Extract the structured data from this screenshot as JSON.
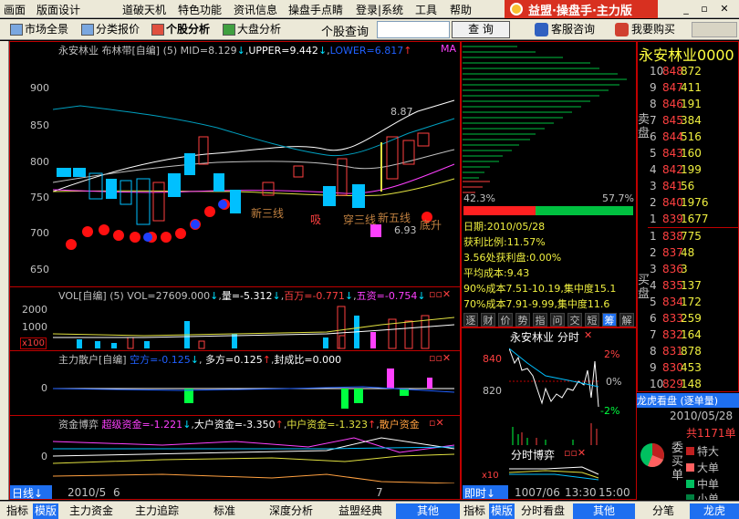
{
  "menu": [
    "画面",
    "版面设计",
    "道破天机",
    "特色功能",
    "资讯信息",
    "操盘手点睛",
    "登录|系统",
    "工具",
    "帮助"
  ],
  "brand": "益盟·操盘手·主力版",
  "toolbar": {
    "items": [
      "市场全景",
      "分类报价",
      "个股分析",
      "大盘分析"
    ],
    "search_label": "个股查询",
    "search_value": "",
    "search_button": "查 询",
    "service": "客服咨询",
    "buy": "我要购买"
  },
  "stock": {
    "name": "永安林业",
    "code": "0000"
  },
  "main_chart": {
    "title": "永安林业 布林带[自编] (5)",
    "mid": "MID=8.129",
    "upper": "UPPER=9.442",
    "lower": "LOWER=6.817",
    "ma": "MA",
    "y_ticks": [
      "900",
      "850",
      "800",
      "750",
      "700",
      "650"
    ],
    "annotations": {
      "high": "8.87",
      "low": "6.93"
    },
    "signals": [
      "新三线",
      "吸",
      "穿三线",
      "新五线",
      "底升"
    ]
  },
  "vol_panel": {
    "title": "VOL[自编] (5) VOL=27609.000",
    "t2": "量=-5.312",
    "t3": "百万=-0.771",
    "t4": "五资=-0.754",
    "y_ticks": [
      "2000",
      "1000"
    ],
    "unit": "x100"
  },
  "zhuli_panel": {
    "title": "主力散户[自编]",
    "t1": "空方=-0.125",
    "t2": "多方=0.125",
    "t3": "封成比=0.000",
    "y_ticks": [
      "0"
    ]
  },
  "boyi_panel": {
    "title": "资金博弈",
    "t1": "超级资金=-1.221",
    "t2": "大户资金=-3.350",
    "t3": "中户资金=-1.323",
    "t4": "散户资金",
    "y_ticks": [
      "0"
    ]
  },
  "x_axis": {
    "period": "日线",
    "dates": [
      "2010/5",
      "6",
      "7"
    ]
  },
  "profile": {
    "pct_left": "42.3%",
    "pct_right": "57.7%",
    "lines": [
      "日期:2010/05/28",
      "获利比例:11.57%",
      "3.56处获利盘:0.00%",
      "平均成本:9.43",
      "90%成本7.51-10.19,集中度15.1",
      "70%成本7.91-9.99,集中度11.6"
    ],
    "tabs": [
      "逐",
      "财",
      "价",
      "势",
      "指",
      "问",
      "交",
      "短",
      "筹",
      "解"
    ]
  },
  "intraday": {
    "title": "永安林业 分时",
    "y_left": [
      "840",
      "820"
    ],
    "y_right": [
      "2%",
      "0%",
      "-2%"
    ],
    "vol_unit": "x10",
    "boyi_title": "分时博弈",
    "period": "即时",
    "dates": [
      "1007/06",
      "13:30",
      "15:00"
    ]
  },
  "orderbook": {
    "sell_label": "卖盘",
    "buy_label": "买盘",
    "sells": [
      {
        "n": "10",
        "p": "848",
        "v": "872"
      },
      {
        "n": "9",
        "p": "847",
        "v": "411"
      },
      {
        "n": "8",
        "p": "846",
        "v": "191"
      },
      {
        "n": "7",
        "p": "845",
        "v": "384"
      },
      {
        "n": "6",
        "p": "844",
        "v": "516"
      },
      {
        "n": "5",
        "p": "843",
        "v": "160"
      },
      {
        "n": "4",
        "p": "842",
        "v": "199"
      },
      {
        "n": "3",
        "p": "841",
        "v": "56"
      },
      {
        "n": "2",
        "p": "840",
        "v": "1976"
      },
      {
        "n": "1",
        "p": "839",
        "v": "1677"
      }
    ],
    "buys": [
      {
        "n": "1",
        "p": "838",
        "v": "775"
      },
      {
        "n": "2",
        "p": "837",
        "v": "48"
      },
      {
        "n": "3",
        "p": "836",
        "v": "3"
      },
      {
        "n": "4",
        "p": "835",
        "v": "137"
      },
      {
        "n": "5",
        "p": "834",
        "v": "172"
      },
      {
        "n": "6",
        "p": "833",
        "v": "259"
      },
      {
        "n": "7",
        "p": "832",
        "v": "164"
      },
      {
        "n": "8",
        "p": "831",
        "v": "878"
      },
      {
        "n": "9",
        "p": "830",
        "v": "453"
      },
      {
        "n": "10",
        "p": "829",
        "v": "148"
      }
    ]
  },
  "dragon": {
    "title": "龙虎看盘 (逐单量)",
    "date": "2010/05/28",
    "total": "共1171单",
    "side": "委买单",
    "legend": [
      "特大",
      "大单",
      "中单",
      "小单"
    ]
  },
  "bottom_tabs": {
    "left": [
      "指标",
      "模版",
      "主力资金",
      "主力追踪",
      "标准",
      "深度分析",
      "益盟经典",
      "其他"
    ],
    "mid": [
      "指标",
      "模版",
      "分时看盘",
      "其他"
    ],
    "right": [
      "分笔",
      "龙虎"
    ]
  },
  "colors": {
    "up": "#ff3030",
    "down": "#00e0ff",
    "accent": "#1e6ff0"
  }
}
